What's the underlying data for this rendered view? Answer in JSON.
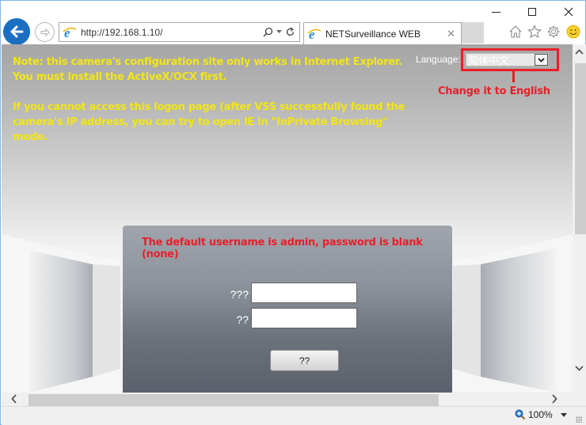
{
  "browser": {
    "address_url": "http://192.168.1.10/",
    "tab_title": "NETSurveillance WEB",
    "icons": {
      "back": "back-arrow-icon",
      "forward": "forward-arrow-icon",
      "site": "internet-explorer-icon",
      "search": "search-icon",
      "refresh": "refresh-icon",
      "home": "home-icon",
      "favorites": "star-icon",
      "tools": "gear-icon",
      "feedback": "smiley-icon"
    },
    "zoom_level": "100%"
  },
  "page": {
    "note_lines": [
      "Note: this camera's configuration site only works in Internet Explorer. You must install the ActiveX/OCX first.",
      "If you cannot access this logon page (after VSS successfully found the camera's IP address, you can try to open IE in \"InPrivate Browsing\" mode."
    ],
    "language_label": "Language:",
    "language_selected": "简体中文",
    "annotation_change_language": "Change it to English",
    "annotation_default_credentials": "The default username is admin, password is blank (none)",
    "login": {
      "username_label": "???",
      "username_value": "",
      "password_label": "??",
      "password_value": "",
      "login_button": "??"
    }
  },
  "colors": {
    "note_text": "#f2e614",
    "annotation_red": "#e8202a",
    "ie_blue": "#1b6fc2"
  }
}
